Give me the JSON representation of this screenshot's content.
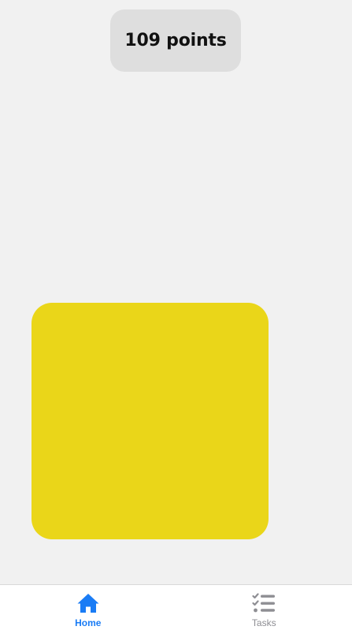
{
  "score": {
    "label": "109 points"
  },
  "target": {
    "color": "#ead619"
  },
  "tabs": [
    {
      "label": "Home",
      "icon": "home-icon",
      "active": true
    },
    {
      "label": "Tasks",
      "icon": "tasks-list-icon",
      "active": false
    }
  ],
  "colors": {
    "accent": "#1a7cf5",
    "inactive": "#8e8e93",
    "background": "#f1f1f1",
    "badge": "#dedede"
  }
}
